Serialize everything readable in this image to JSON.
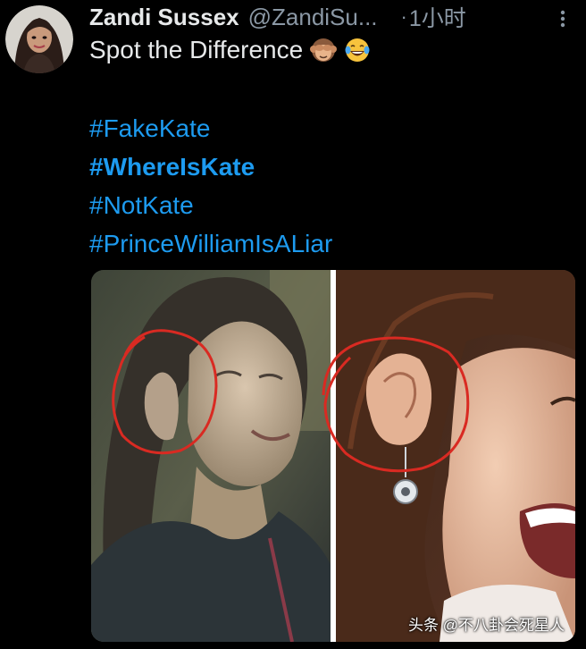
{
  "tweet": {
    "display_name": "Zandi Sussex",
    "handle": "@ZandiSu...",
    "separator": "·",
    "time": "1小时",
    "text": "Spot the Difference",
    "emojis": [
      "see-no-evil-monkey",
      "tears-of-joy"
    ],
    "hashtags": [
      {
        "text": "#FakeKate",
        "bold": false
      },
      {
        "text": "#WhereIsKate",
        "bold": true
      },
      {
        "text": "#NotKate",
        "bold": false
      },
      {
        "text": "#PrinceWilliamIsALiar",
        "bold": false
      }
    ]
  },
  "media": {
    "watermark": "头条 @不八卦会死星人"
  },
  "colors": {
    "background": "#000000",
    "text": "#e7e9ea",
    "secondary": "#8b98a5",
    "link": "#1d9bf0",
    "circle": "#d92a22"
  },
  "icons": {
    "more": "more-vertical-icon"
  }
}
